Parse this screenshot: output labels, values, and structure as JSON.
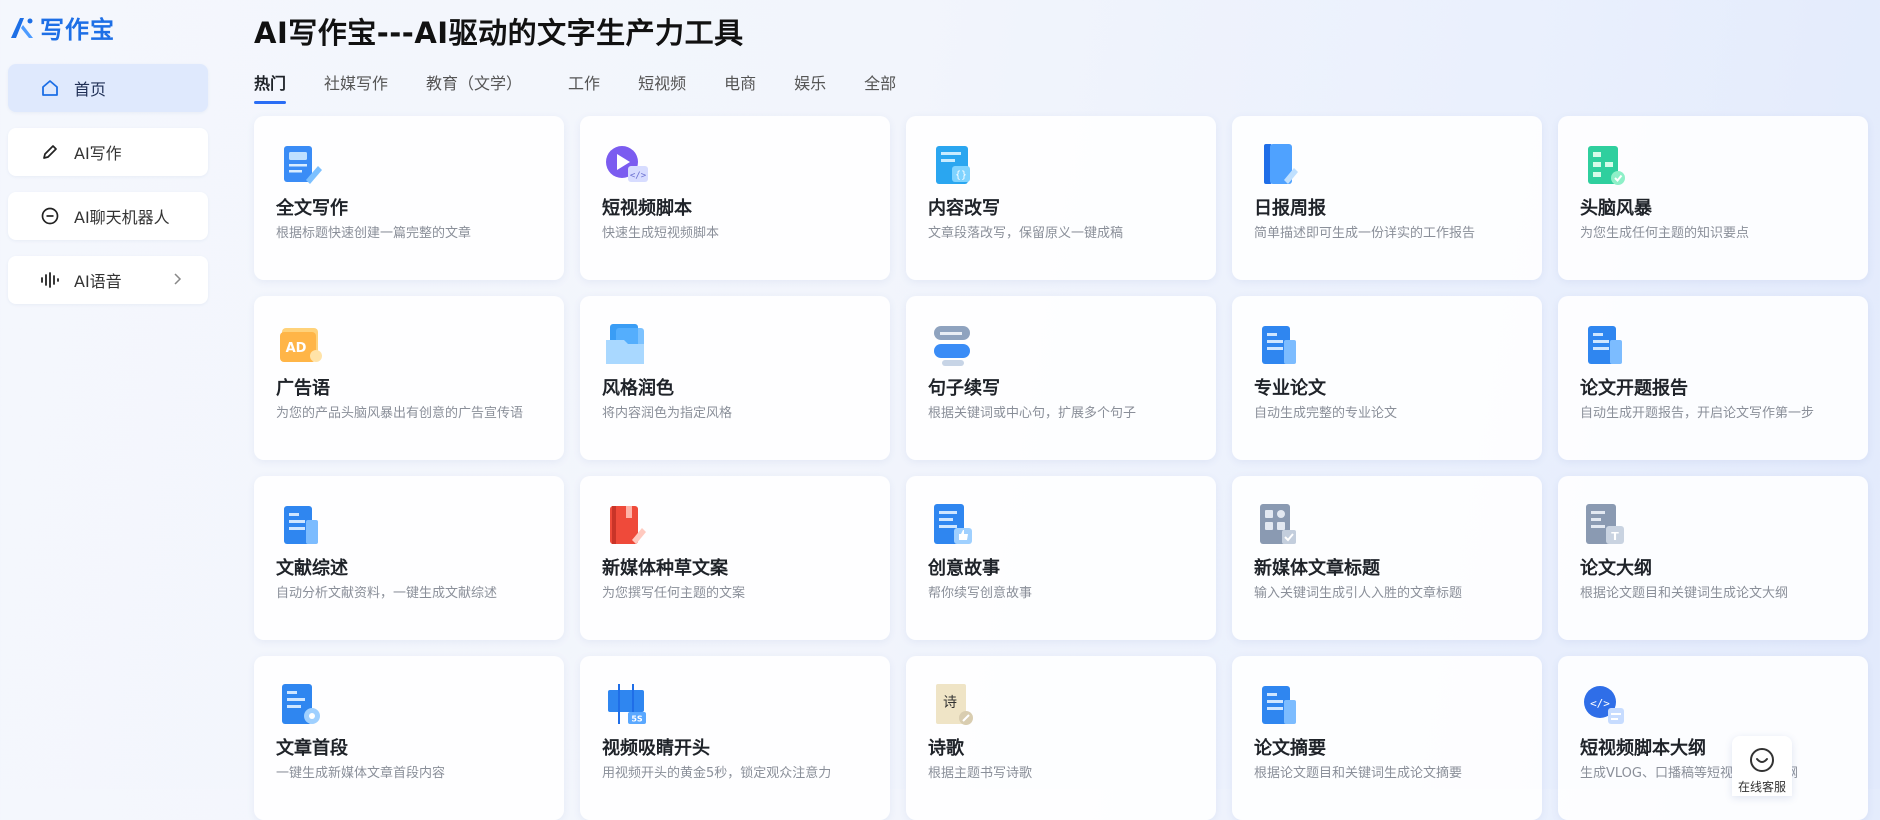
{
  "app": {
    "logo_text": "写作宝",
    "brand_color": "#1d6fe6",
    "accent": "#2a6df5"
  },
  "sidebar": {
    "items": [
      {
        "label": "首页",
        "icon": "home-icon",
        "active": true
      },
      {
        "label": "AI写作",
        "icon": "pen-icon"
      },
      {
        "label": "AI聊天机器人",
        "icon": "chat-bubble-icon"
      },
      {
        "label": "AI语音",
        "icon": "voice-wave-icon",
        "has_submenu": true
      }
    ]
  },
  "main": {
    "title": "AI写作宝---AI驱动的文字生产力工具",
    "tabs": [
      {
        "label": "热门",
        "active": true
      },
      {
        "label": "社媒写作"
      },
      {
        "label": "教育（文学）"
      },
      {
        "label": "工作"
      },
      {
        "label": "短视频"
      },
      {
        "label": "电商"
      },
      {
        "label": "娱乐"
      },
      {
        "label": "全部"
      }
    ],
    "cards": [
      {
        "title": "全文写作",
        "desc": "根据标题快速创建一篇完整的文章",
        "icon": "document-write-icon"
      },
      {
        "title": "短视频脚本",
        "desc": "快速生成短视频脚本",
        "icon": "video-play-script-icon"
      },
      {
        "title": "内容改写",
        "desc": "文章段落改写，保留原义一键成稿",
        "icon": "rewrite-code-icon"
      },
      {
        "title": "日报周报",
        "desc": "简单描述即可生成一份详实的工作报告",
        "icon": "report-book-icon"
      },
      {
        "title": "头脑风暴",
        "desc": "为您生成任何主题的知识要点",
        "icon": "mindmap-icon"
      },
      {
        "title": "广告语",
        "desc": "为您的产品头脑风暴出有创意的广告宣传语",
        "icon": "ad-tag-icon"
      },
      {
        "title": "风格润色",
        "desc": "将内容润色为指定风格",
        "icon": "folder-style-icon"
      },
      {
        "title": "句子续写",
        "desc": "根据关键词或中心句，扩展多个句子",
        "icon": "sentence-blocks-icon"
      },
      {
        "title": "专业论文",
        "desc": "自动生成完整的专业论文",
        "icon": "paper-document-icon"
      },
      {
        "title": "论文开题报告",
        "desc": "自动生成开题报告，开启论文写作第一步",
        "icon": "paper-proposal-icon"
      },
      {
        "title": "文献综述",
        "desc": "自动分析文献资料，一键生成文献综述",
        "icon": "literature-review-icon"
      },
      {
        "title": "新媒体种草文案",
        "desc": "为您撰写任何主题的文案",
        "icon": "red-notebook-icon"
      },
      {
        "title": "创意故事",
        "desc": "帮你续写创意故事",
        "icon": "story-thumbsup-icon"
      },
      {
        "title": "新媒体文章标题",
        "desc": "输入关键词生成引人入胜的文章标题",
        "icon": "headline-grid-icon"
      },
      {
        "title": "论文大纲",
        "desc": "根据论文题目和关键词生成论文大纲",
        "icon": "outline-text-icon"
      },
      {
        "title": "文章首段",
        "desc": "一键生成新媒体文章首段内容",
        "icon": "first-paragraph-gear-icon"
      },
      {
        "title": "视频吸睛开头",
        "desc": "用视频开头的黄金5秒，锁定观众注意力",
        "icon": "video-5s-icon",
        "badge": "5S"
      },
      {
        "title": "诗歌",
        "desc": "根据主题书写诗歌",
        "icon": "poem-scroll-icon",
        "glyph": "诗"
      },
      {
        "title": "论文摘要",
        "desc": "根据论文题目和关键词生成论文摘要",
        "icon": "abstract-document-icon"
      },
      {
        "title": "短视频脚本大纲",
        "desc": "生成VLOG、口播稿等短视频脚本大纲",
        "icon": "video-script-outline-icon"
      }
    ]
  },
  "service": {
    "label": "在线客服",
    "icon": "customer-service-icon"
  }
}
